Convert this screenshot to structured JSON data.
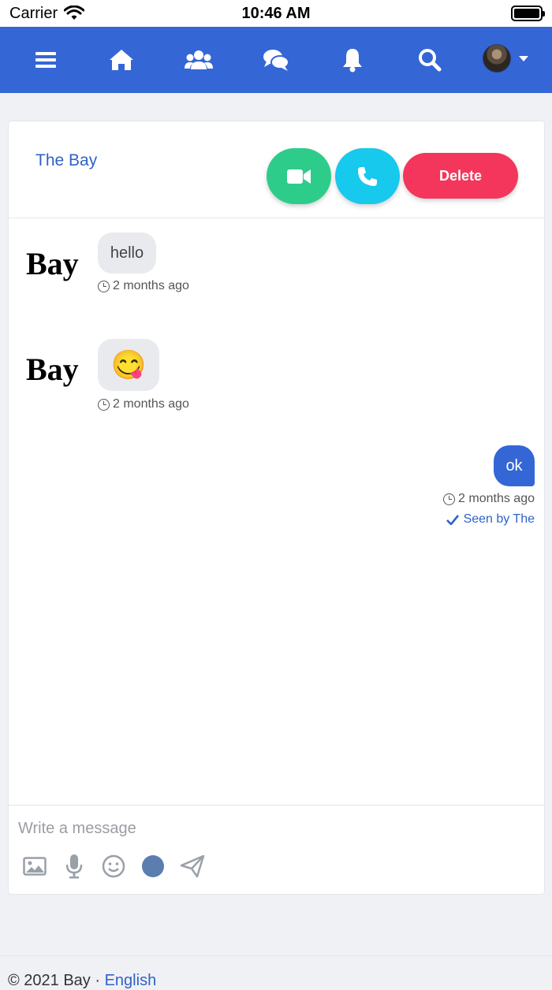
{
  "status_bar": {
    "carrier": "Carrier",
    "time": "10:46 AM"
  },
  "navbar": {
    "icons": [
      "menu-icon",
      "home-icon",
      "users-icon",
      "chat-icon",
      "bell-icon",
      "search-icon",
      "avatar"
    ],
    "accent": "#3466d6"
  },
  "chat": {
    "title": "The Bay",
    "buttons": {
      "video_icon": "video-icon",
      "call_icon": "phone-icon",
      "delete_label": "Delete"
    },
    "messages": [
      {
        "sender": "Bay",
        "text": "hello",
        "time": "2 months ago"
      },
      {
        "sender": "Bay",
        "text": "😋",
        "time": "2 months ago"
      },
      {
        "text": "ok",
        "time": "2 months ago",
        "seen": "Seen by The"
      }
    ]
  },
  "composer": {
    "placeholder": "Write a message",
    "tools": [
      "image-icon",
      "microphone-icon",
      "smiley-icon",
      "color-icon",
      "send-icon"
    ]
  },
  "footer": {
    "copyright": "© 2021 Bay",
    "language": "English"
  },
  "colors": {
    "video": "#2ecc8a",
    "call": "#17c9ec",
    "delete": "#f5365c",
    "link": "#2f62c9"
  }
}
